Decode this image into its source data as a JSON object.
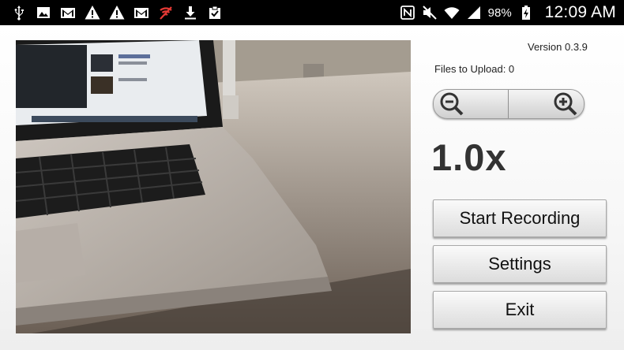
{
  "status_bar": {
    "left_icons": [
      "usb-icon",
      "image-icon",
      "gmail-icon",
      "warning-icon",
      "warning-icon",
      "gmail-icon",
      "wifi-off-icon",
      "download-icon",
      "clipboard-check-icon"
    ],
    "right_icons": [
      "nfc-icon",
      "mute-icon",
      "wifi-icon",
      "signal-icon",
      "battery-charging-icon"
    ],
    "battery": "98%",
    "time": "12:09 AM"
  },
  "app": {
    "version": "Version 0.3.9",
    "files_to_upload": "Files to Upload: 0",
    "zoom_level": "1.0x",
    "buttons": {
      "start_recording": "Start Recording",
      "settings": "Settings",
      "exit": "Exit"
    }
  },
  "colors": {
    "status_bar_bg": "#000000",
    "zoom_text": "#333333"
  }
}
